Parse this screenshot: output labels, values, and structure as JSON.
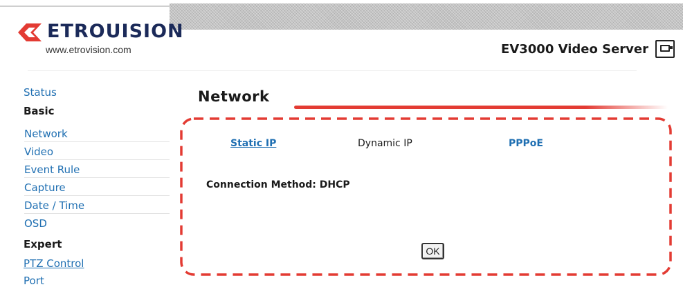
{
  "header": {
    "logo_text": "ETROUISION",
    "logo_url": "www.etrovision.com",
    "product_title": "EV3000 Video Server",
    "product_icon": "camera-icon"
  },
  "sidebar": {
    "items": [
      {
        "label": "Status",
        "kind": "link"
      },
      {
        "label": "Basic",
        "kind": "heading"
      },
      {
        "label": "Network",
        "kind": "link"
      },
      {
        "label": "Video",
        "kind": "link"
      },
      {
        "label": "Event Rule",
        "kind": "link"
      },
      {
        "label": "Capture",
        "kind": "link"
      },
      {
        "label": "Date / Time",
        "kind": "link"
      },
      {
        "label": "OSD",
        "kind": "link"
      },
      {
        "label": "Expert",
        "kind": "heading"
      },
      {
        "label": "PTZ Control",
        "kind": "link"
      },
      {
        "label": "Port",
        "kind": "link"
      }
    ]
  },
  "main": {
    "title": "Network",
    "tabs": [
      {
        "label": "Static IP"
      },
      {
        "label": "Dynamic IP"
      },
      {
        "label": "PPPoE"
      }
    ],
    "connection_method": "Connection Method: DHCP",
    "ok_label": "OK"
  },
  "colors": {
    "link": "#1f6fb2",
    "accent_red": "#e33b33",
    "logo_navy": "#1b2a59"
  }
}
